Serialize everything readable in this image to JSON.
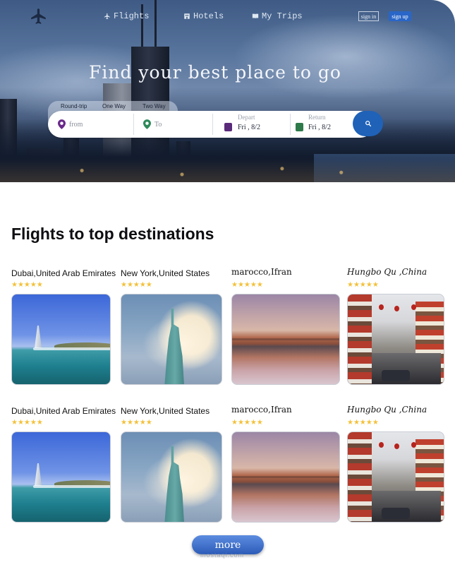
{
  "nav": {
    "logo_icon": "airplane-icon",
    "items": [
      {
        "label": "Flights",
        "icon": "airplane-icon"
      },
      {
        "label": "Hotels",
        "icon": "hotel-icon"
      },
      {
        "label": "My Trips",
        "icon": "book-icon"
      }
    ],
    "sign_in": "sign in",
    "sign_up": "sign up"
  },
  "hero": {
    "title": "Find your best place to go",
    "trip_types": [
      "Round-trip",
      "One Way",
      "Two Way"
    ],
    "search": {
      "from_placeholder": "from",
      "to_placeholder": "To",
      "depart_label": "Depart",
      "depart_value": "Fri , 8/2",
      "return_label": "Return",
      "return_value": "Fri , 8/2",
      "button_icon": "search-icon"
    }
  },
  "section": {
    "title": "Flights to top destinations"
  },
  "destinations_row1": [
    {
      "name": "Dubai,United Arab Emirates",
      "stars": "★★★★★",
      "rating": 5
    },
    {
      "name": "New York,United States",
      "stars": "★★★★★",
      "rating": 5
    },
    {
      "name": "marocco,Ifran",
      "stars": "★★★★★",
      "rating": 5
    },
    {
      "name": "Hungbo Qu ,China",
      "stars": "★★★★★",
      "rating": 5
    }
  ],
  "destinations_row2": [
    {
      "name": "Dubai,United Arab Emirates",
      "stars": "★★★★★",
      "rating": 5
    },
    {
      "name": "New York,United States",
      "stars": "★★★★★",
      "rating": 5
    },
    {
      "name": "marocco,Ifran",
      "stars": "★★★★★",
      "rating": 5
    },
    {
      "name": "Hungbo Qu ,China",
      "stars": "★★★★★",
      "rating": 5
    }
  ],
  "more_button": "more",
  "watermark": "mostaql.com",
  "colors": {
    "accent": "#1f62b8",
    "sign_up_bg": "#2a66c8",
    "star": "#f3c13a",
    "pin_from": "#6a2a8a",
    "pin_to": "#2e8a5a",
    "cal_depart": "#5a2a7a",
    "cal_return": "#2e7a4a"
  }
}
